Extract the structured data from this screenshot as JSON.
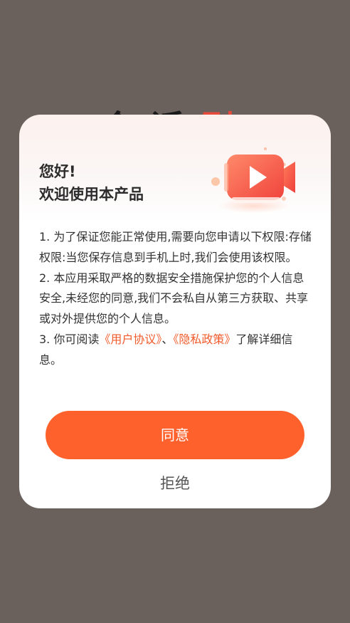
{
  "background": {
    "ghost_title_dark": "会话",
    "ghost_title_accent": "剧"
  },
  "dialog": {
    "greeting_line1": "您好!",
    "greeting_line2": "欢迎使用本产品",
    "illustration_icon": "video-camera-icon",
    "p1_a": "1. 为了保证您能正常使用,需要向您申请以下权限:",
    "p1_b": "存储权限:当您保存信息到手机上时,我们会使用该权限。",
    "p2": "2. 本应用采取严格的数据安全措施保护您的个人信息安全,未经您的同意,我们不会私自从第三方获取、共享或对外提供您的个人信息。",
    "p3_prefix": "3. 你可阅读",
    "user_agreement_link": "《用户协议》",
    "p3_sep": "、",
    "privacy_policy_link": "《隐私政策》",
    "p3_suffix": "了解详细信息。",
    "agree_label": "同意",
    "refuse_label": "拒绝"
  },
  "colors": {
    "overlay": "#6a605c",
    "accent": "#fe612c",
    "link": "#f05a2a",
    "text": "#333333"
  }
}
